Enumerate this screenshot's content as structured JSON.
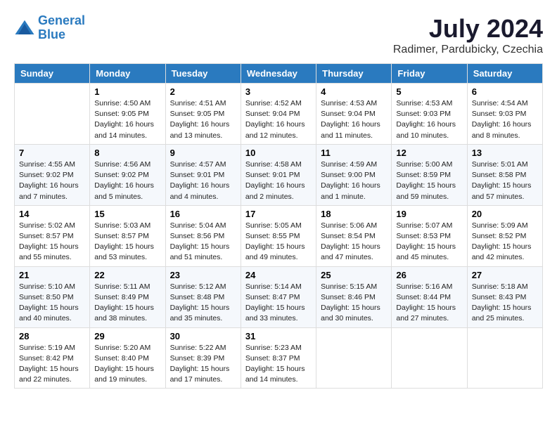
{
  "logo": {
    "line1": "General",
    "line2": "Blue"
  },
  "title": "July 2024",
  "location": "Radimer, Pardubicky, Czechia",
  "days_header": [
    "Sunday",
    "Monday",
    "Tuesday",
    "Wednesday",
    "Thursday",
    "Friday",
    "Saturday"
  ],
  "weeks": [
    [
      {
        "day": "",
        "sunrise": "",
        "sunset": "",
        "daylight": ""
      },
      {
        "day": "1",
        "sunrise": "Sunrise: 4:50 AM",
        "sunset": "Sunset: 9:05 PM",
        "daylight": "Daylight: 16 hours and 14 minutes."
      },
      {
        "day": "2",
        "sunrise": "Sunrise: 4:51 AM",
        "sunset": "Sunset: 9:05 PM",
        "daylight": "Daylight: 16 hours and 13 minutes."
      },
      {
        "day": "3",
        "sunrise": "Sunrise: 4:52 AM",
        "sunset": "Sunset: 9:04 PM",
        "daylight": "Daylight: 16 hours and 12 minutes."
      },
      {
        "day": "4",
        "sunrise": "Sunrise: 4:53 AM",
        "sunset": "Sunset: 9:04 PM",
        "daylight": "Daylight: 16 hours and 11 minutes."
      },
      {
        "day": "5",
        "sunrise": "Sunrise: 4:53 AM",
        "sunset": "Sunset: 9:03 PM",
        "daylight": "Daylight: 16 hours and 10 minutes."
      },
      {
        "day": "6",
        "sunrise": "Sunrise: 4:54 AM",
        "sunset": "Sunset: 9:03 PM",
        "daylight": "Daylight: 16 hours and 8 minutes."
      }
    ],
    [
      {
        "day": "7",
        "sunrise": "Sunrise: 4:55 AM",
        "sunset": "Sunset: 9:02 PM",
        "daylight": "Daylight: 16 hours and 7 minutes."
      },
      {
        "day": "8",
        "sunrise": "Sunrise: 4:56 AM",
        "sunset": "Sunset: 9:02 PM",
        "daylight": "Daylight: 16 hours and 5 minutes."
      },
      {
        "day": "9",
        "sunrise": "Sunrise: 4:57 AM",
        "sunset": "Sunset: 9:01 PM",
        "daylight": "Daylight: 16 hours and 4 minutes."
      },
      {
        "day": "10",
        "sunrise": "Sunrise: 4:58 AM",
        "sunset": "Sunset: 9:01 PM",
        "daylight": "Daylight: 16 hours and 2 minutes."
      },
      {
        "day": "11",
        "sunrise": "Sunrise: 4:59 AM",
        "sunset": "Sunset: 9:00 PM",
        "daylight": "Daylight: 16 hours and 1 minute."
      },
      {
        "day": "12",
        "sunrise": "Sunrise: 5:00 AM",
        "sunset": "Sunset: 8:59 PM",
        "daylight": "Daylight: 15 hours and 59 minutes."
      },
      {
        "day": "13",
        "sunrise": "Sunrise: 5:01 AM",
        "sunset": "Sunset: 8:58 PM",
        "daylight": "Daylight: 15 hours and 57 minutes."
      }
    ],
    [
      {
        "day": "14",
        "sunrise": "Sunrise: 5:02 AM",
        "sunset": "Sunset: 8:57 PM",
        "daylight": "Daylight: 15 hours and 55 minutes."
      },
      {
        "day": "15",
        "sunrise": "Sunrise: 5:03 AM",
        "sunset": "Sunset: 8:57 PM",
        "daylight": "Daylight: 15 hours and 53 minutes."
      },
      {
        "day": "16",
        "sunrise": "Sunrise: 5:04 AM",
        "sunset": "Sunset: 8:56 PM",
        "daylight": "Daylight: 15 hours and 51 minutes."
      },
      {
        "day": "17",
        "sunrise": "Sunrise: 5:05 AM",
        "sunset": "Sunset: 8:55 PM",
        "daylight": "Daylight: 15 hours and 49 minutes."
      },
      {
        "day": "18",
        "sunrise": "Sunrise: 5:06 AM",
        "sunset": "Sunset: 8:54 PM",
        "daylight": "Daylight: 15 hours and 47 minutes."
      },
      {
        "day": "19",
        "sunrise": "Sunrise: 5:07 AM",
        "sunset": "Sunset: 8:53 PM",
        "daylight": "Daylight: 15 hours and 45 minutes."
      },
      {
        "day": "20",
        "sunrise": "Sunrise: 5:09 AM",
        "sunset": "Sunset: 8:52 PM",
        "daylight": "Daylight: 15 hours and 42 minutes."
      }
    ],
    [
      {
        "day": "21",
        "sunrise": "Sunrise: 5:10 AM",
        "sunset": "Sunset: 8:50 PM",
        "daylight": "Daylight: 15 hours and 40 minutes."
      },
      {
        "day": "22",
        "sunrise": "Sunrise: 5:11 AM",
        "sunset": "Sunset: 8:49 PM",
        "daylight": "Daylight: 15 hours and 38 minutes."
      },
      {
        "day": "23",
        "sunrise": "Sunrise: 5:12 AM",
        "sunset": "Sunset: 8:48 PM",
        "daylight": "Daylight: 15 hours and 35 minutes."
      },
      {
        "day": "24",
        "sunrise": "Sunrise: 5:14 AM",
        "sunset": "Sunset: 8:47 PM",
        "daylight": "Daylight: 15 hours and 33 minutes."
      },
      {
        "day": "25",
        "sunrise": "Sunrise: 5:15 AM",
        "sunset": "Sunset: 8:46 PM",
        "daylight": "Daylight: 15 hours and 30 minutes."
      },
      {
        "day": "26",
        "sunrise": "Sunrise: 5:16 AM",
        "sunset": "Sunset: 8:44 PM",
        "daylight": "Daylight: 15 hours and 27 minutes."
      },
      {
        "day": "27",
        "sunrise": "Sunrise: 5:18 AM",
        "sunset": "Sunset: 8:43 PM",
        "daylight": "Daylight: 15 hours and 25 minutes."
      }
    ],
    [
      {
        "day": "28",
        "sunrise": "Sunrise: 5:19 AM",
        "sunset": "Sunset: 8:42 PM",
        "daylight": "Daylight: 15 hours and 22 minutes."
      },
      {
        "day": "29",
        "sunrise": "Sunrise: 5:20 AM",
        "sunset": "Sunset: 8:40 PM",
        "daylight": "Daylight: 15 hours and 19 minutes."
      },
      {
        "day": "30",
        "sunrise": "Sunrise: 5:22 AM",
        "sunset": "Sunset: 8:39 PM",
        "daylight": "Daylight: 15 hours and 17 minutes."
      },
      {
        "day": "31",
        "sunrise": "Sunrise: 5:23 AM",
        "sunset": "Sunset: 8:37 PM",
        "daylight": "Daylight: 15 hours and 14 minutes."
      },
      {
        "day": "",
        "sunrise": "",
        "sunset": "",
        "daylight": ""
      },
      {
        "day": "",
        "sunrise": "",
        "sunset": "",
        "daylight": ""
      },
      {
        "day": "",
        "sunrise": "",
        "sunset": "",
        "daylight": ""
      }
    ]
  ]
}
